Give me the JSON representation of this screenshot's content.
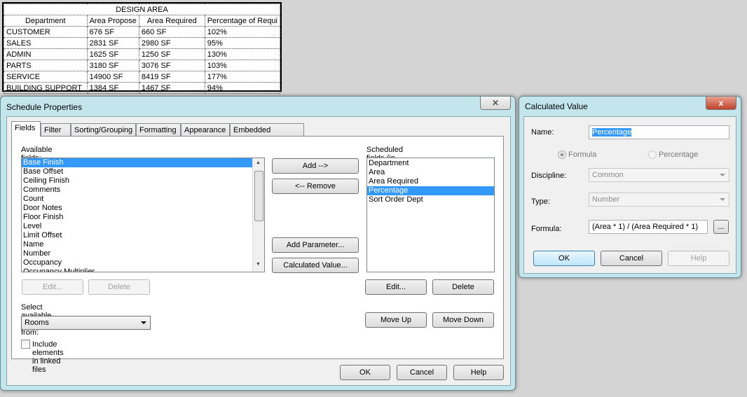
{
  "schedule": {
    "title": "DESIGN AREA",
    "headers": [
      "Department",
      "Area Propose",
      "Area Required",
      "Percentage of Requi"
    ],
    "rows": [
      [
        "CUSTOMER",
        "676 SF",
        "660 SF",
        "102%"
      ],
      [
        "SALES",
        "2831 SF",
        "2980 SF",
        "95%"
      ],
      [
        "ADMIN",
        "1625 SF",
        "1250 SF",
        "130%"
      ],
      [
        "PARTS",
        "3180 SF",
        "3076 SF",
        "103%"
      ],
      [
        "SERVICE",
        "14900 SF",
        "8419 SF",
        "177%"
      ],
      [
        "BUILDING SUPPORT",
        "1384 SF",
        "1467 SF",
        "94%"
      ]
    ]
  },
  "schedule_properties": {
    "title": "Schedule Properties",
    "tabs": [
      "Fields",
      "Filter",
      "Sorting/Grouping",
      "Formatting",
      "Appearance",
      "Embedded Schedule"
    ],
    "available_label": "Available fields:",
    "available": [
      "Base Finish",
      "Base Offset",
      "Ceiling Finish",
      "Comments",
      "Count",
      "Door Notes",
      "Floor Finish",
      "Level",
      "Limit Offset",
      "Name",
      "Number",
      "Occupancy",
      "Occupancy Multiplier"
    ],
    "scheduled_label": "Scheduled fields (in order):",
    "scheduled": [
      "Department",
      "Area",
      "Area Required",
      "Percentage",
      "Sort Order Dept"
    ],
    "add": "Add -->",
    "remove": "<-- Remove",
    "add_parameter": "Add Parameter...",
    "calculated_value": "Calculated Value...",
    "edit": "Edit...",
    "delete": "Delete",
    "move_up": "Move Up",
    "move_down": "Move Down",
    "select_from_label": "Select available fields from:",
    "select_from": "Rooms",
    "include_linked": "Include elements in linked files",
    "ok": "OK",
    "cancel": "Cancel",
    "help": "Help"
  },
  "calculated": {
    "title": "Calculated Value",
    "close": "x",
    "name_label": "Name:",
    "name": "Percentage",
    "formula_radio": "Formula",
    "percentage_radio": "Percentage",
    "discipline_label": "Discipline:",
    "discipline": "Common",
    "type_label": "Type:",
    "type": "Number",
    "formula_label": "Formula:",
    "formula": "(Area * 1) / (Area Required * 1)",
    "browse": "...",
    "ok": "OK",
    "cancel": "Cancel",
    "help": "Help"
  }
}
